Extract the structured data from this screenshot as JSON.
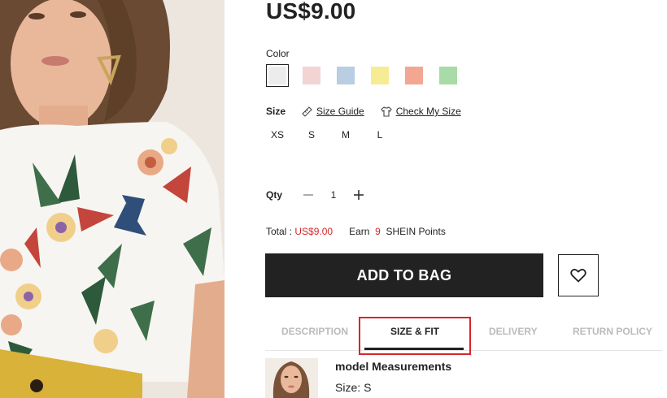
{
  "product": {
    "price": "US$9.00"
  },
  "color": {
    "label": "Color",
    "swatches": [
      {
        "name": "white",
        "hex": "#ececec",
        "selected": true
      },
      {
        "name": "pink",
        "hex": "#f2d4d4"
      },
      {
        "name": "blue",
        "hex": "#b9cde3"
      },
      {
        "name": "yellow",
        "hex": "#f6ec93"
      },
      {
        "name": "coral",
        "hex": "#f3a792"
      },
      {
        "name": "green",
        "hex": "#a8dba8"
      }
    ]
  },
  "size": {
    "label": "Size",
    "guide_link": "Size Guide",
    "check_link": "Check My Size",
    "options": [
      "XS",
      "S",
      "M",
      "L"
    ]
  },
  "qty": {
    "label": "Qty",
    "minus_icon": "minus-icon",
    "value": "1",
    "plus_icon": "plus-icon"
  },
  "total": {
    "label": "Total :",
    "amount": "US$9.00",
    "earn_label": "Earn",
    "points": "9",
    "points_label": "SHEIN Points"
  },
  "actions": {
    "add_to_bag": "ADD TO BAG",
    "wishlist_icon": "heart-icon"
  },
  "tabs": [
    {
      "label": "DESCRIPTION",
      "active": false
    },
    {
      "label": "SIZE & FIT",
      "active": true
    },
    {
      "label": "DELIVERY",
      "active": false
    },
    {
      "label": "RETURN POLICY",
      "active": false
    }
  ],
  "model": {
    "title": "model Measurements",
    "size_label": "Size:",
    "size_value": "S"
  },
  "colors": {
    "accent_red": "#d7262b",
    "button_dark": "#222222"
  }
}
